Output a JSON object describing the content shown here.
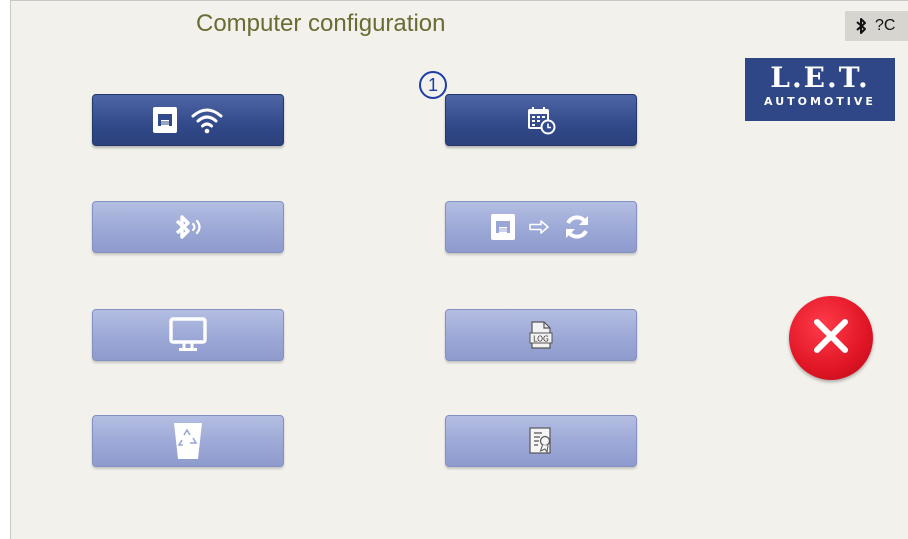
{
  "header": {
    "title": "Computer configuration",
    "status": {
      "bluetooth_icon": "bluetooth-icon",
      "help_text": "?C"
    }
  },
  "logo": {
    "line1": "L.E.T.",
    "line2": "AUTOMOTIVE"
  },
  "badge": {
    "number": "1"
  },
  "buttons": [
    {
      "name": "network-wifi-button",
      "icons": [
        "ethernet-icon",
        "wifi-icon"
      ],
      "state": "active"
    },
    {
      "name": "date-time-button",
      "icons": [
        "calendar-clock-icon"
      ],
      "state": "active"
    },
    {
      "name": "bluetooth-button",
      "icons": [
        "bluetooth-signal-icon"
      ],
      "state": "inactive"
    },
    {
      "name": "network-sync-button",
      "icons": [
        "ethernet-icon",
        "arrow-right-icon",
        "refresh-icon"
      ],
      "state": "inactive"
    },
    {
      "name": "display-button",
      "icons": [
        "monitor-icon"
      ],
      "state": "inactive"
    },
    {
      "name": "log-button",
      "icons": [
        "log-file-icon"
      ],
      "state": "inactive"
    },
    {
      "name": "recycle-button",
      "icons": [
        "recycle-bin-icon"
      ],
      "state": "inactive"
    },
    {
      "name": "certificate-button",
      "icons": [
        "certificate-icon"
      ],
      "state": "inactive"
    }
  ],
  "close": {
    "icon": "close-icon",
    "color": "#e01525"
  },
  "colors": {
    "title": "#6b6b33",
    "button_active": "#32498a",
    "button_inactive": "#9aa6d5",
    "logo_bg": "#2f4787",
    "background": "#f2f1ec"
  }
}
